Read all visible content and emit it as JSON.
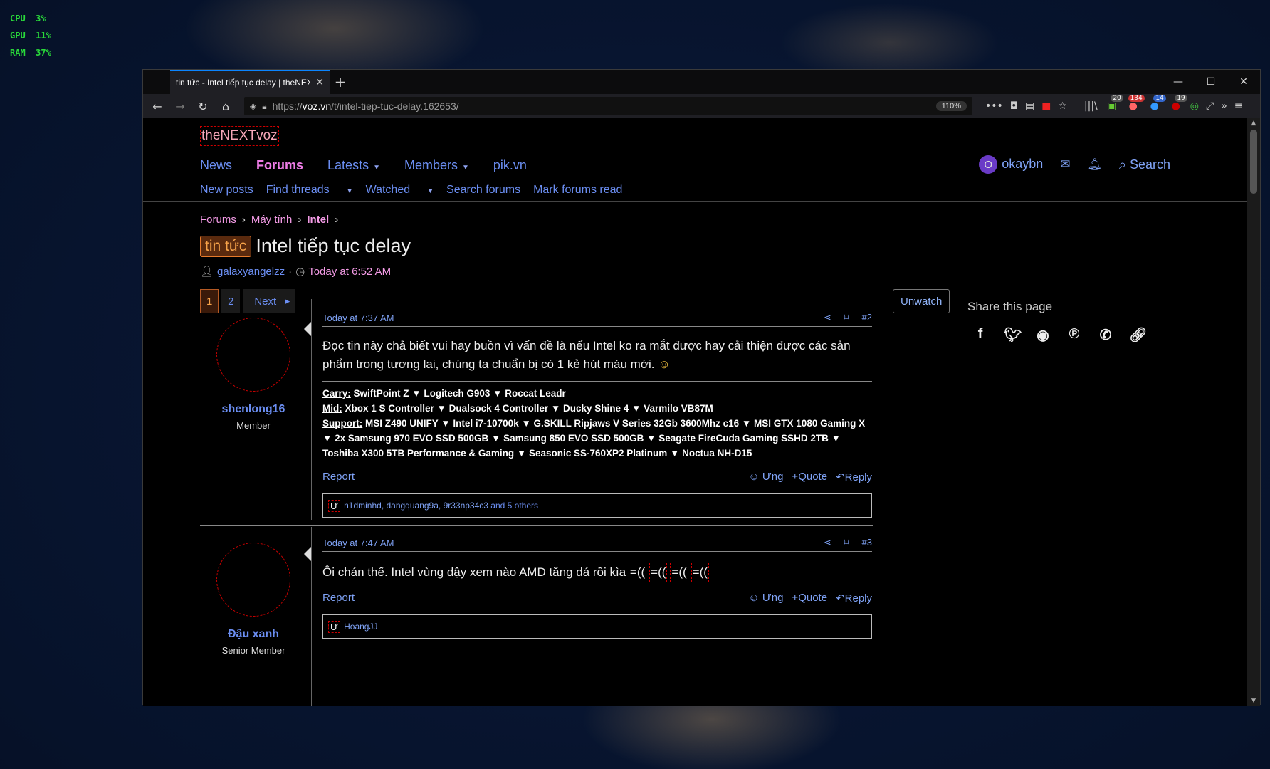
{
  "perf": {
    "cpu": "CPU  3%",
    "gpu": "GPU  11%",
    "ram": "RAM  37%"
  },
  "browser": {
    "tab_title": "tin tức - Intel tiếp tục delay | theNEXTvoz",
    "url_prefix": "https://",
    "url_host": "voz.vn",
    "url_path": "/t/intel-tiep-tuc-delay.162653/",
    "zoom": "110%",
    "badges": {
      "b1": "20",
      "b2": "134",
      "b3": "14",
      "b4": "19"
    }
  },
  "site": {
    "logo": "theNEXTvoz",
    "nav": {
      "news": "News",
      "forums": "Forums",
      "latests": "Latests",
      "members": "Members",
      "pik": "pik.vn"
    },
    "user": {
      "initial": "O",
      "name": "okaybn",
      "search": "Search"
    },
    "subnav": {
      "new_posts": "New posts",
      "find_threads": "Find threads",
      "watched": "Watched",
      "search_forums": "Search forums",
      "mark_read": "Mark forums read"
    }
  },
  "thread": {
    "breadcrumbs": [
      "Forums",
      "Máy tính",
      "Intel"
    ],
    "prefix": "tin tức",
    "title": "Intel tiếp tục delay",
    "author": "galaxyangelzz",
    "time": "Today at 6:52 AM",
    "pages": [
      "1",
      "2"
    ],
    "next": "Next",
    "unwatch": "Unwatch"
  },
  "share": {
    "title": "Share this page"
  },
  "posts": [
    {
      "username": "shenlong16",
      "role": "Member",
      "timestamp": "Today at 7:37 AM",
      "number": "#2",
      "message": "Đọc tin này chả biết vui hay buồn vì vấn đề là nếu Intel ko ra mắt được hay cải thiện được các sản phẩm trong tương lai, chúng ta chuẩn bị có 1 kẻ hút máu mới.",
      "sig_carry_label": "Carry:",
      "sig_carry": " SwiftPoint Z ▼ Logitech G903 ▼ Roccat Leadr",
      "sig_mid_label": "Mid:",
      "sig_mid": " Xbox 1 S Controller ▼ Dualsock 4 Controller ▼ Ducky Shine 4 ▼ Varmilo VB87M",
      "sig_support_label": "Support:",
      "sig_support": " MSI Z490 UNIFY ▼ Intel i7-10700k ▼ G.SKILL Ripjaws V Series 32Gb 3600Mhz c16 ▼ MSI GTX 1080 Gaming X ▼ 2x Samsung 970 EVO SSD 500GB ▼ Samsung 850 EVO SSD 500GB ▼ Seagate FireCuda Gaming SSHD 2TB ▼ Toshiba X300 5TB Performance & Gaming ▼ Seasonic SS-760XP2 Platinum ▼ Noctua NH-D15",
      "report": "Report",
      "ung": "Ưng",
      "quote": "Quote",
      "reply": "Reply",
      "likes_icon": "Ư",
      "likes": "n1dminhd, dangquang9a, 9r33np34c3",
      "likes_more": " and 5 others"
    },
    {
      "username": "Đậu xanh",
      "role": "Senior Member",
      "timestamp": "Today at 7:47 AM",
      "number": "#3",
      "message": "Ôi chán thế. Intel vùng dậy xem nào AMD tăng dá rồi kìa",
      "emote": "=((",
      "report": "Report",
      "ung": "Ưng",
      "quote": "Quote",
      "reply": "Reply",
      "likes_icon": "Ư",
      "likes": "HoangJJ"
    }
  ]
}
